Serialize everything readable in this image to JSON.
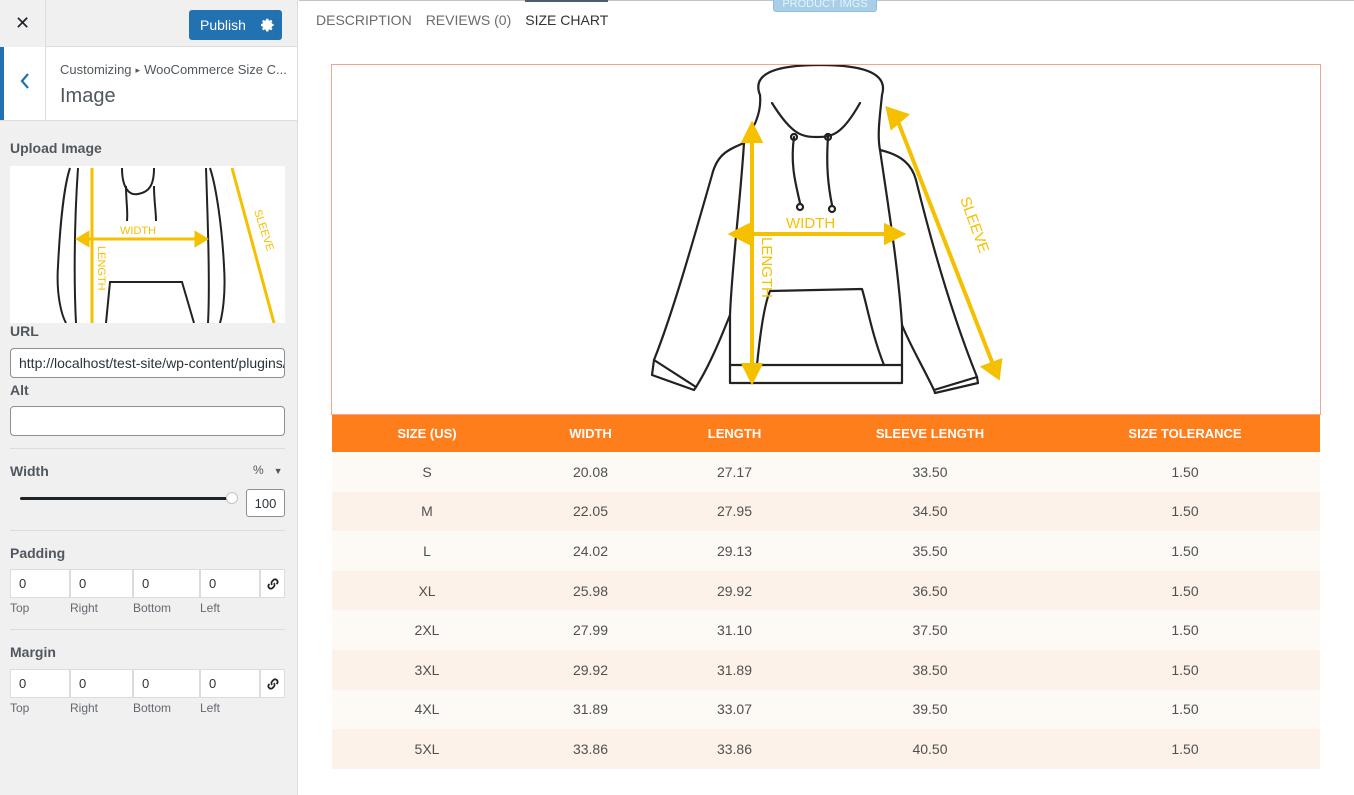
{
  "sidebar": {
    "close_icon": "close-icon",
    "publish_label": "Publish",
    "breadcrumb_root": "Customizing",
    "breadcrumb_section": "WooCommerce Size C...",
    "section_title": "Image",
    "upload_label": "Upload Image",
    "preview_texts": {
      "width": "WIDTH",
      "length": "LENGTH",
      "sleeve": "SLEEVE"
    },
    "url_label": "URL",
    "url_value": "http://localhost/test-site/wp-content/plugins/",
    "alt_label": "Alt",
    "alt_value": "",
    "width_label": "Width",
    "width_unit": "%",
    "width_value": "100",
    "width_slider_fraction": 1.0,
    "padding_label": "Padding",
    "padding": {
      "top": "0",
      "right": "0",
      "bottom": "0",
      "left": "0"
    },
    "margin_label": "Margin",
    "margin": {
      "top": "0",
      "right": "0",
      "bottom": "0",
      "left": "0"
    },
    "side_labels": {
      "top": "Top",
      "right": "Right",
      "bottom": "Bottom",
      "left": "Left"
    }
  },
  "preview": {
    "floating_tag": "PRODUCT IMGS",
    "tabs": [
      "DESCRIPTION",
      "REVIEWS (0)",
      "SIZE CHART"
    ],
    "active_tab": "SIZE CHART",
    "diagram_labels": {
      "width": "WIDTH",
      "length": "LENGTH",
      "sleeve": "SLEEVE"
    },
    "accent_color": "#fd7e1b",
    "arrow_color": "#f5c000",
    "table": {
      "headers": [
        "SIZE (US)",
        "WIDTH",
        "LENGTH",
        "SLEEVE LENGTH",
        "SIZE TOLERANCE"
      ],
      "rows": [
        [
          "S",
          "20.08",
          "27.17",
          "33.50",
          "1.50"
        ],
        [
          "M",
          "22.05",
          "27.95",
          "34.50",
          "1.50"
        ],
        [
          "L",
          "24.02",
          "29.13",
          "35.50",
          "1.50"
        ],
        [
          "XL",
          "25.98",
          "29.92",
          "36.50",
          "1.50"
        ],
        [
          "2XL",
          "27.99",
          "31.10",
          "37.50",
          "1.50"
        ],
        [
          "3XL",
          "29.92",
          "31.89",
          "38.50",
          "1.50"
        ],
        [
          "4XL",
          "31.89",
          "33.07",
          "39.50",
          "1.50"
        ],
        [
          "5XL",
          "33.86",
          "33.86",
          "40.50",
          "1.50"
        ]
      ]
    }
  }
}
